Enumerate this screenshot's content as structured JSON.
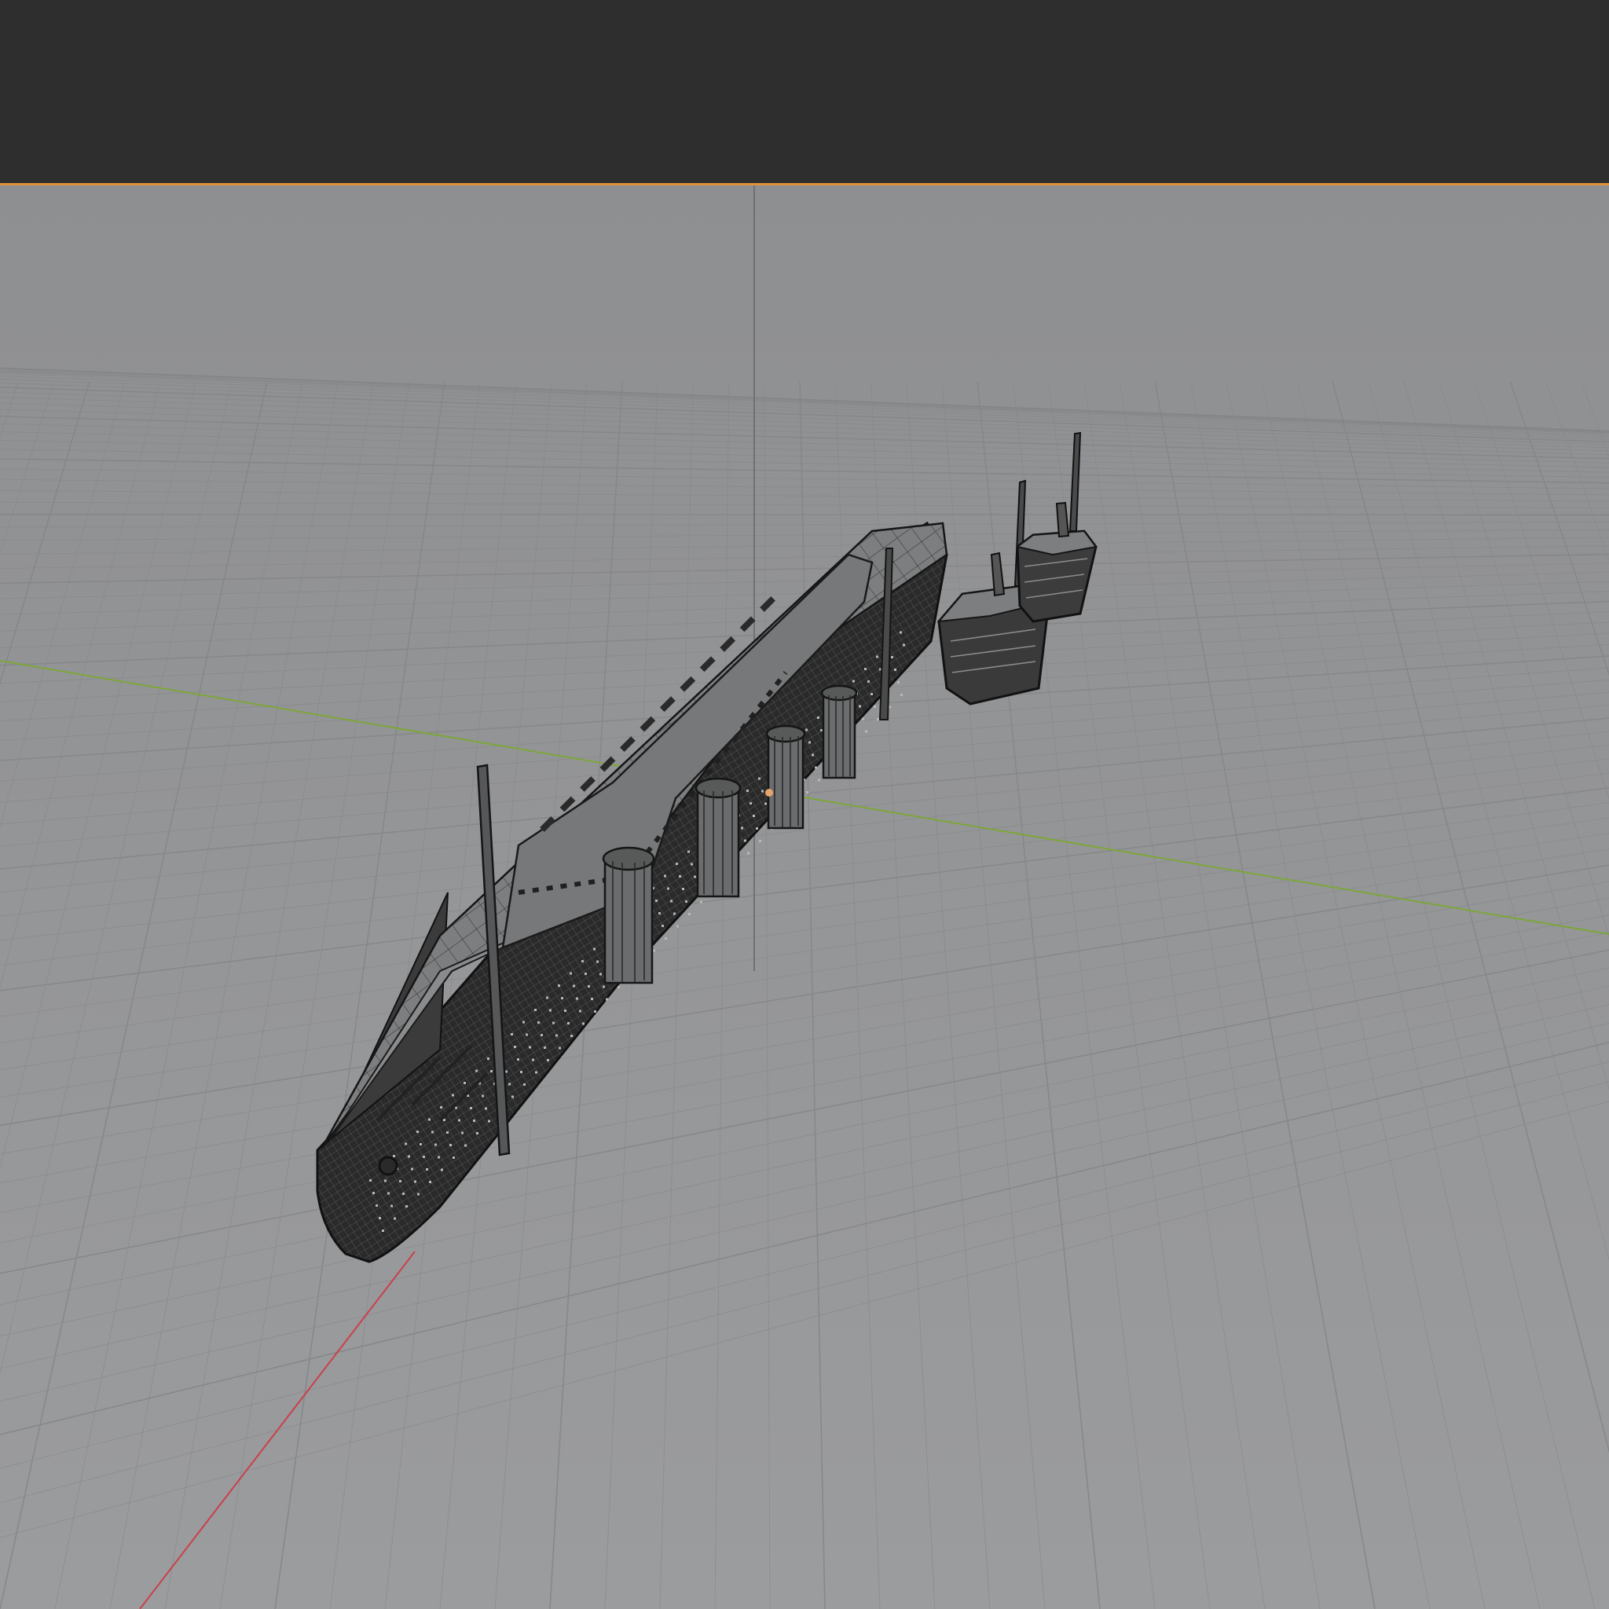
{
  "editor": {
    "type": "3D Viewport",
    "shading_mode": "wireframe",
    "accent_color": "#e0913a",
    "header_bg": "#2e2e2e",
    "viewport_bg": "#969798",
    "grid_color": "#858688",
    "axis_colors": {
      "x": "#c9404a",
      "y": "#7ea63a",
      "z": "#6f7072"
    },
    "wire_color": "#1e1e1e",
    "origin_color": "#e7a46b"
  },
  "scene": {
    "objects": [
      {
        "name-icon": "ship-hull-icon",
        "role": "main-hull"
      },
      {
        "name-icon": "ship-section-icon",
        "role": "stern-section-1"
      },
      {
        "name-icon": "ship-section-icon",
        "role": "stern-section-2"
      }
    ]
  }
}
